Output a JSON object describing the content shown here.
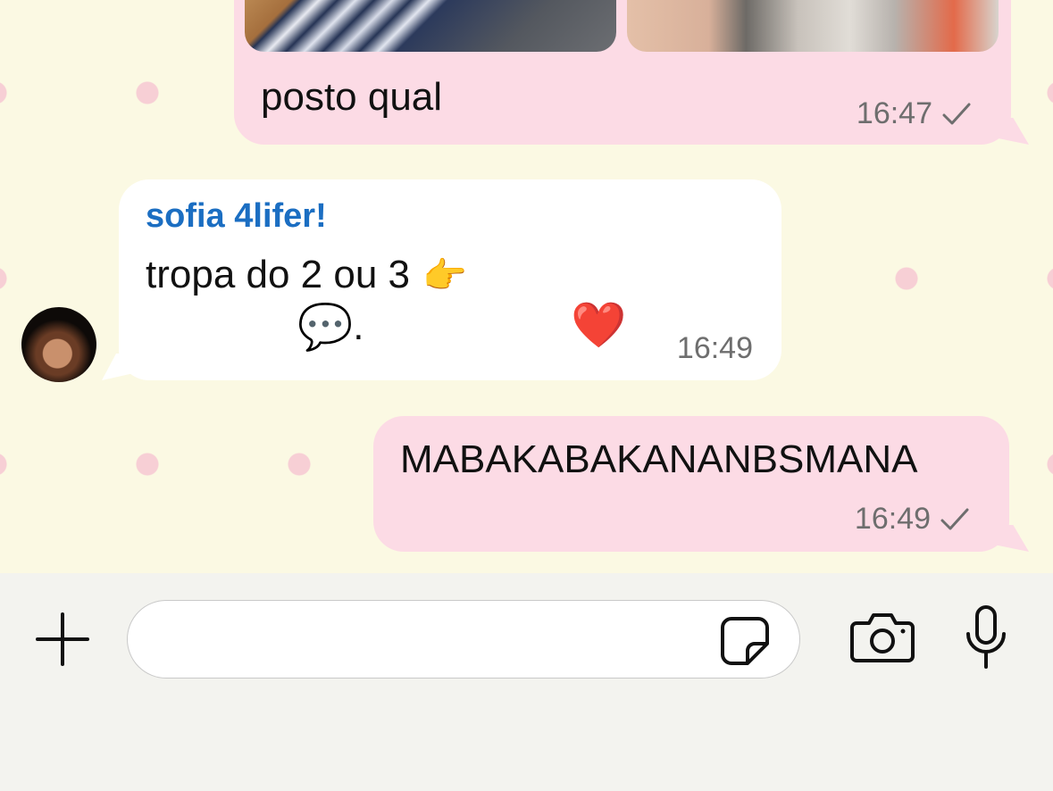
{
  "messages": [
    {
      "direction": "outgoing",
      "has_photos": true,
      "text": "posto qual",
      "time": "16:47",
      "status": "sent"
    },
    {
      "direction": "incoming",
      "sender": "sofia 4lifer!",
      "line1_text": "tropa do 2 ou 3",
      "line1_emoji": "👉",
      "line2_emoji": "💬",
      "line2_text": ".",
      "reaction": "❤️",
      "time": "16:49"
    },
    {
      "direction": "outgoing",
      "text": "MABAKABAKANANBSMANA",
      "time": "16:49",
      "status": "sent"
    }
  ],
  "composer": {
    "placeholder": "",
    "icons": [
      "plus-icon",
      "sticker-icon",
      "camera-icon",
      "microphone-icon"
    ]
  },
  "colors": {
    "outgoing_bubble": "#fcdbe5",
    "incoming_bubble": "#ffffff",
    "sender_name": "#1b6ec2",
    "wallpaper": "#fbf9e3",
    "wallpaper_dots": "#f7cfd5"
  }
}
